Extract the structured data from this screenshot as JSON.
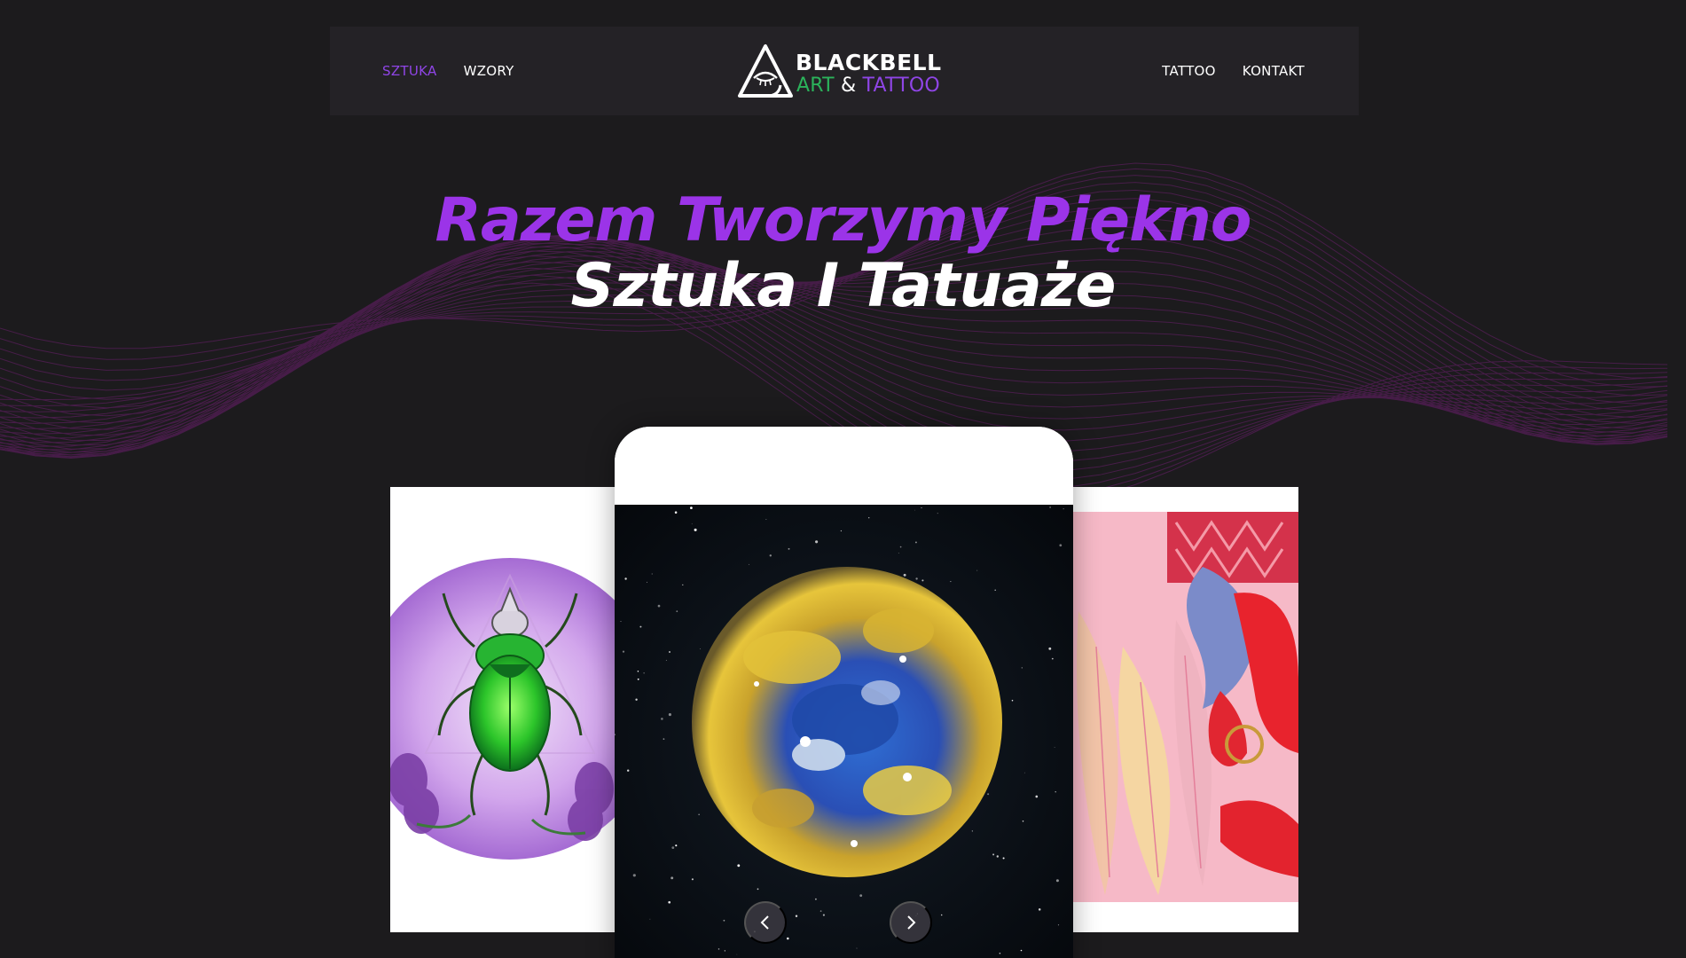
{
  "nav": {
    "left": [
      {
        "label": "SZTUKA",
        "active": true
      },
      {
        "label": "WZORY",
        "active": false
      }
    ],
    "right": [
      {
        "label": "TATTOO",
        "active": false
      },
      {
        "label": "KONTAKT",
        "active": false
      }
    ]
  },
  "logo": {
    "line1": "BLACKBELL",
    "art": "ART",
    "amp": "&",
    "tattoo": "TATTOO"
  },
  "hero": {
    "line1": "Razem Tworzymy Piękno",
    "line2": "Sztuka I Tatuaże"
  },
  "slider": {
    "slides": [
      "beetle-artwork",
      "planet-artwork",
      "flamingo-artwork"
    ],
    "active_index": 1
  },
  "colors": {
    "accent_purple": "#8f45e6",
    "logo_green": "#2bb35b",
    "background": "#1c1b1d",
    "header_bg": "#242226"
  }
}
